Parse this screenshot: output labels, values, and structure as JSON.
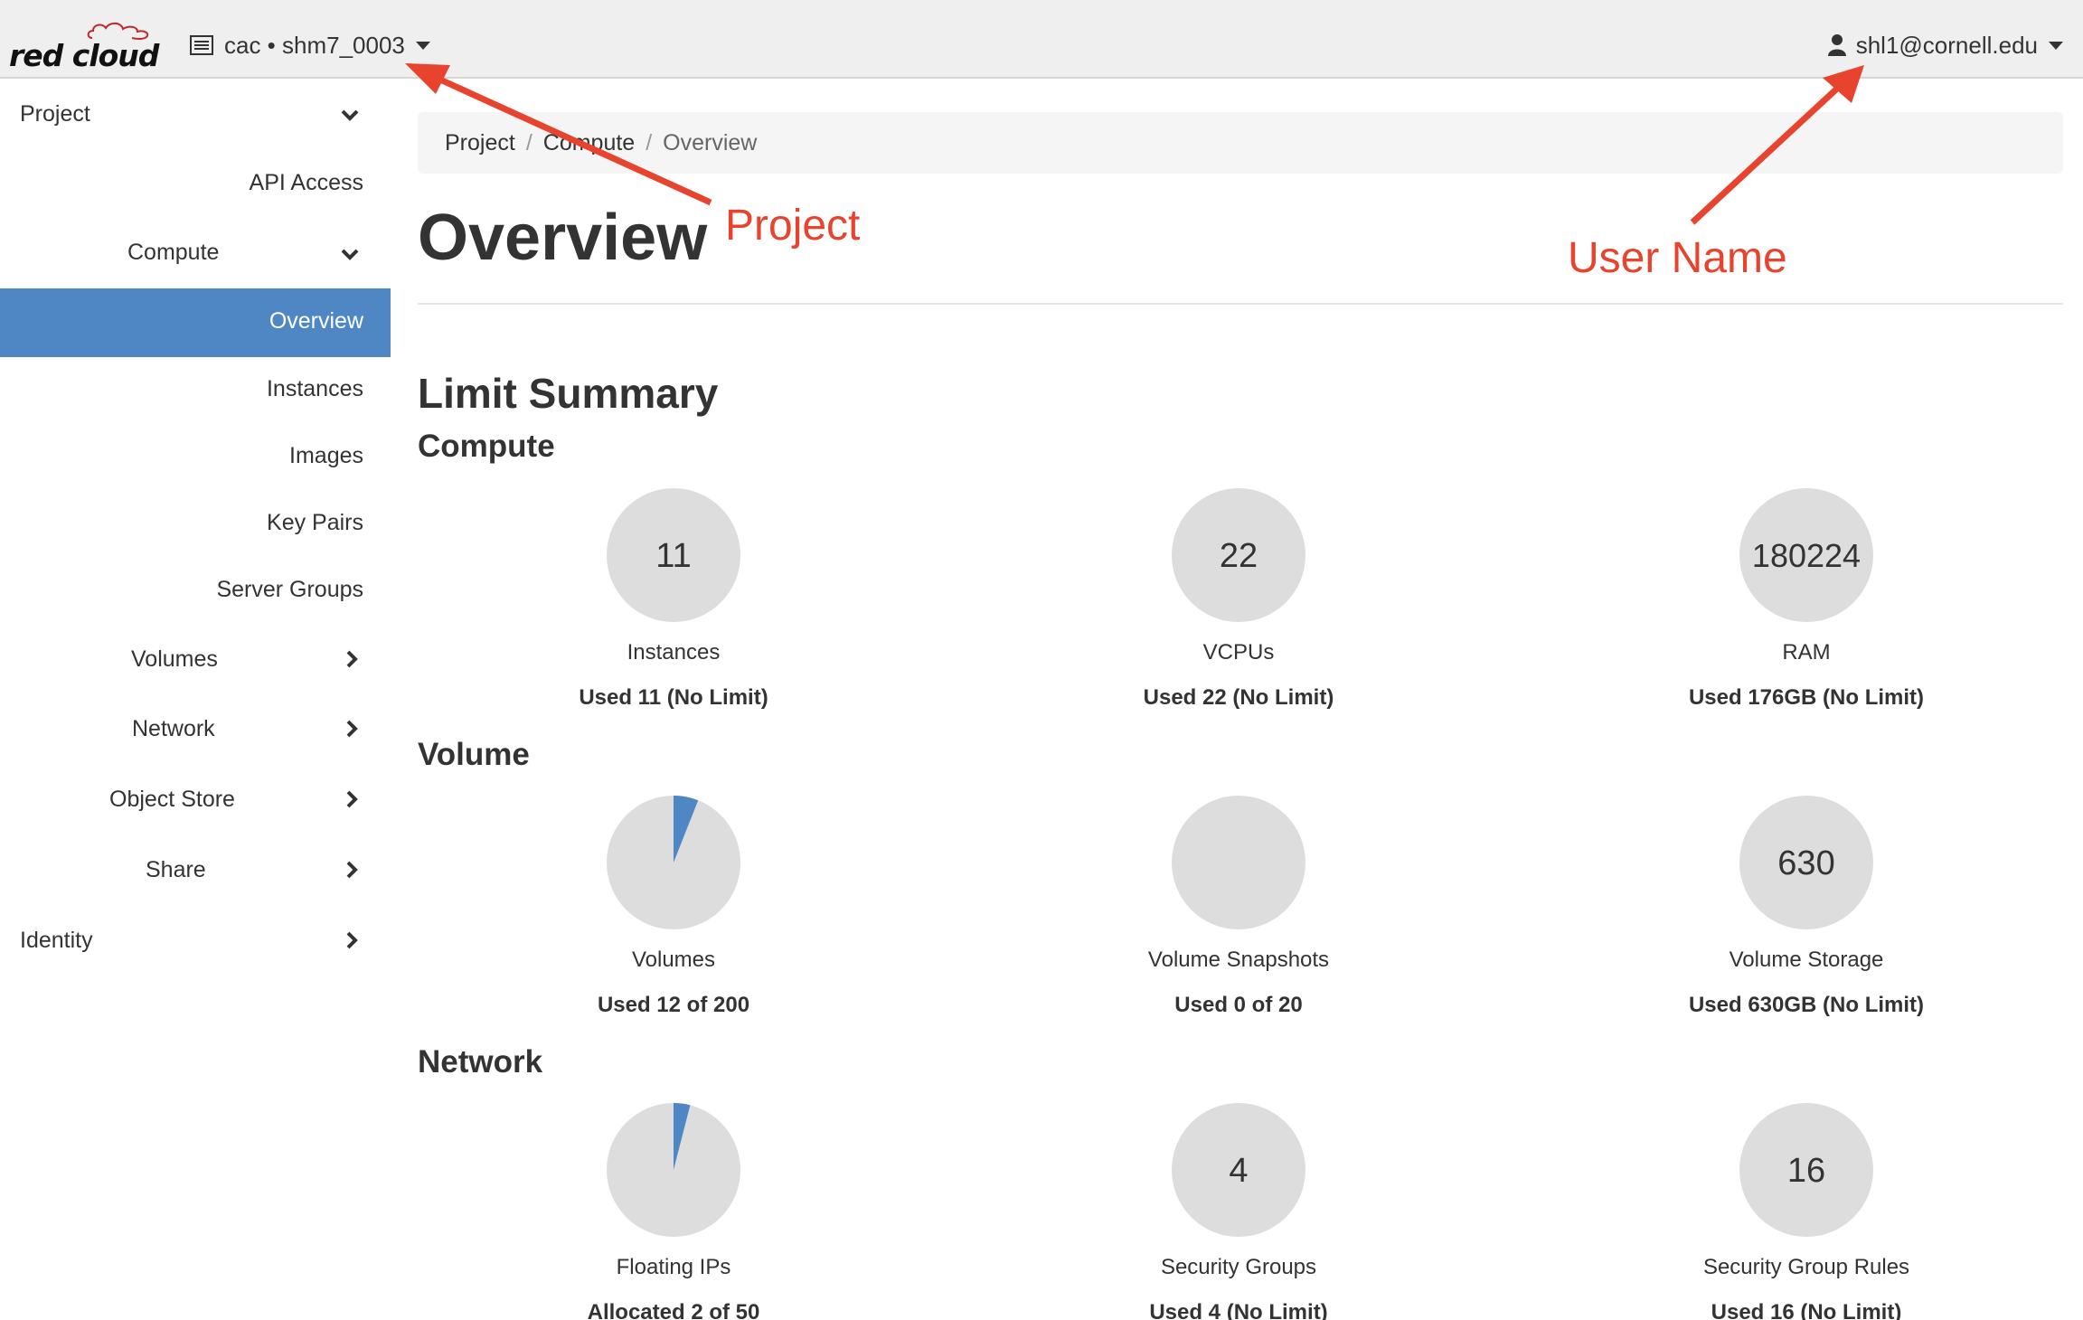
{
  "topbar": {
    "logo_text": "red cloud",
    "project_selector": "cac • shm7_0003",
    "user": "shl1@cornell.edu"
  },
  "sidebar": {
    "project": "Project",
    "api_access": "API Access",
    "compute": "Compute",
    "overview": "Overview",
    "instances": "Instances",
    "images": "Images",
    "key_pairs": "Key Pairs",
    "server_groups": "Server Groups",
    "volumes": "Volumes",
    "network": "Network",
    "object_store": "Object Store",
    "share": "Share",
    "identity": "Identity"
  },
  "breadcrumb": [
    "Project",
    "Compute",
    "Overview"
  ],
  "page": {
    "title": "Overview",
    "limit_summary": "Limit Summary"
  },
  "sections": [
    {
      "heading": "Compute",
      "charts": [
        {
          "value_text": "11",
          "label": "Instances",
          "usage": "Used 11 (No Limit)",
          "used": 11,
          "limit": null
        },
        {
          "value_text": "22",
          "label": "VCPUs",
          "usage": "Used 22 (No Limit)",
          "used": 22,
          "limit": null
        },
        {
          "value_text": "180224",
          "label": "RAM",
          "usage": "Used 176GB (No Limit)",
          "used": 180224,
          "limit": null
        }
      ]
    },
    {
      "heading": "Volume",
      "charts": [
        {
          "value_text": "",
          "label": "Volumes",
          "usage": "Used 12 of 200",
          "used": 12,
          "limit": 200
        },
        {
          "value_text": "",
          "label": "Volume Snapshots",
          "usage": "Used 0 of 20",
          "used": 0,
          "limit": 20
        },
        {
          "value_text": "630",
          "label": "Volume Storage",
          "usage": "Used 630GB (No Limit)",
          "used": 630,
          "limit": null
        }
      ]
    },
    {
      "heading": "Network",
      "charts": [
        {
          "value_text": "",
          "label": "Floating IPs",
          "usage": "Allocated 2 of 50",
          "used": 2,
          "limit": 50
        },
        {
          "value_text": "4",
          "label": "Security Groups",
          "usage": "Used 4 (No Limit)",
          "used": 4,
          "limit": null
        },
        {
          "value_text": "16",
          "label": "Security Group Rules",
          "usage": "Used 16 (No Limit)",
          "used": 16,
          "limit": null
        }
      ]
    }
  ],
  "annotations": {
    "project_label": "Project",
    "user_label": "User Name"
  },
  "colors": {
    "accent": "#4e87c3",
    "pie_bg": "#dddddd",
    "annotation": "#e8432e",
    "topbar": "#efefef"
  }
}
